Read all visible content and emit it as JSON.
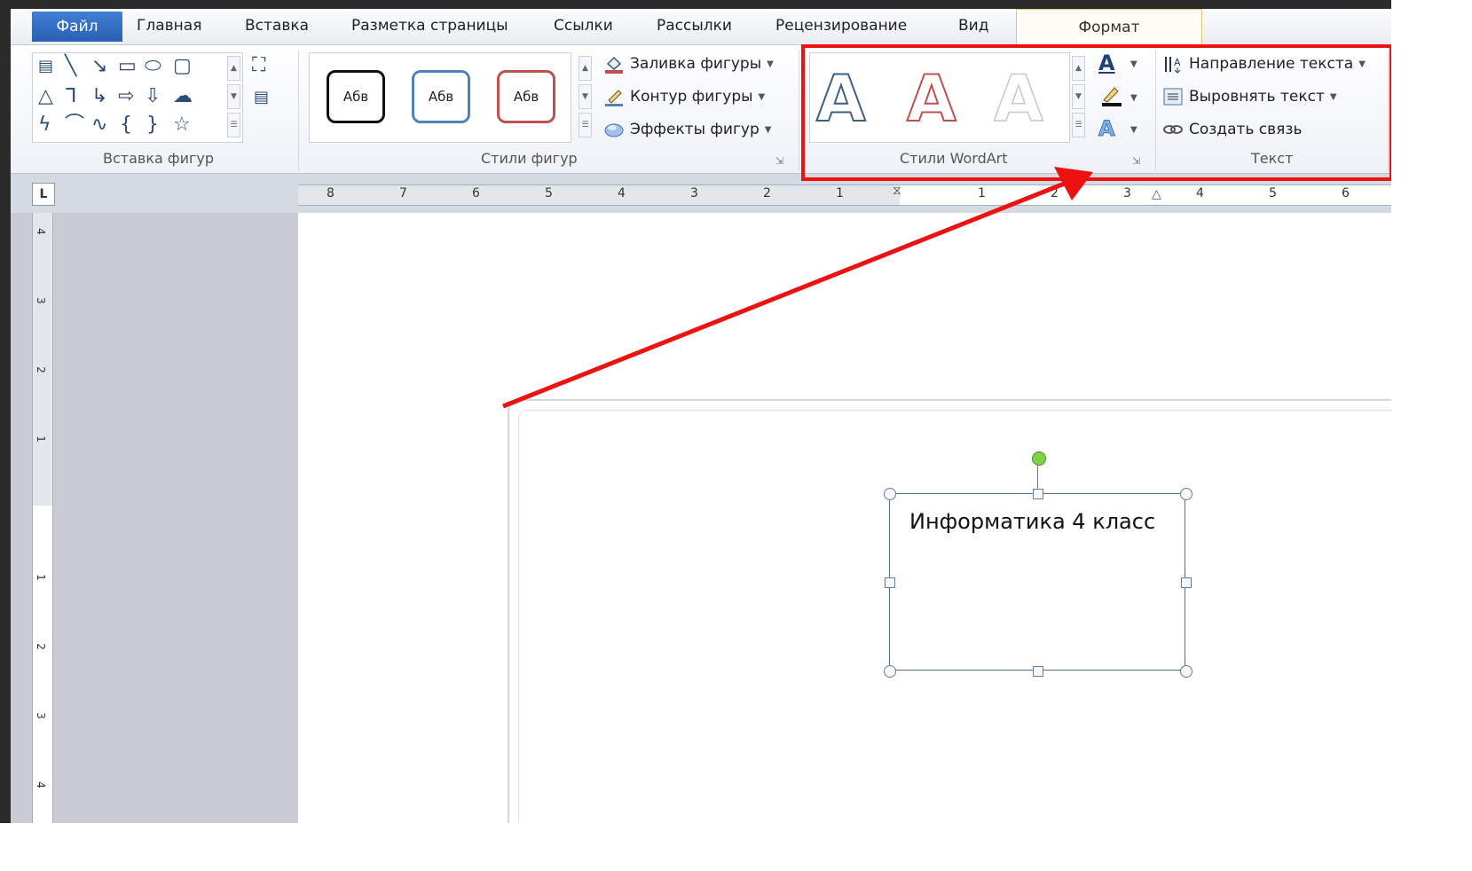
{
  "tabs": {
    "file": "Файл",
    "home": "Главная",
    "insert": "Вставка",
    "page_layout": "Разметка страницы",
    "references": "Ссылки",
    "mailings": "Рассылки",
    "review": "Рецензирование",
    "view": "Вид",
    "format": "Формат"
  },
  "ribbon": {
    "insert_shapes": {
      "label": "Вставка фигур"
    },
    "shape_styles": {
      "label": "Стили фигур",
      "previews": [
        "Абв",
        "Абв",
        "Абв"
      ],
      "fill": "Заливка фигуры",
      "outline": "Контур фигуры",
      "effects": "Эффекты фигур"
    },
    "wordart_styles": {
      "label": "Стили WordArt",
      "previews": [
        "A",
        "A",
        "A"
      ]
    },
    "text": {
      "label": "Текст",
      "direction": "Направление текста",
      "align": "Выровнять текст",
      "link": "Создать связь"
    }
  },
  "ruler": {
    "horizontal_numbers": [
      "8",
      "7",
      "6",
      "5",
      "4",
      "3",
      "2",
      "1",
      "1",
      "2",
      "3",
      "4",
      "5",
      "6"
    ],
    "vertical_numbers": [
      "4",
      "3",
      "2",
      "1",
      "1",
      "2",
      "3",
      "4"
    ]
  },
  "document": {
    "textbox_text": "Информатика 4 класс"
  },
  "colors": {
    "file_tab": "#2a5fb3",
    "highlight": "#ee1111",
    "rotation_handle": "#7ed04a"
  }
}
